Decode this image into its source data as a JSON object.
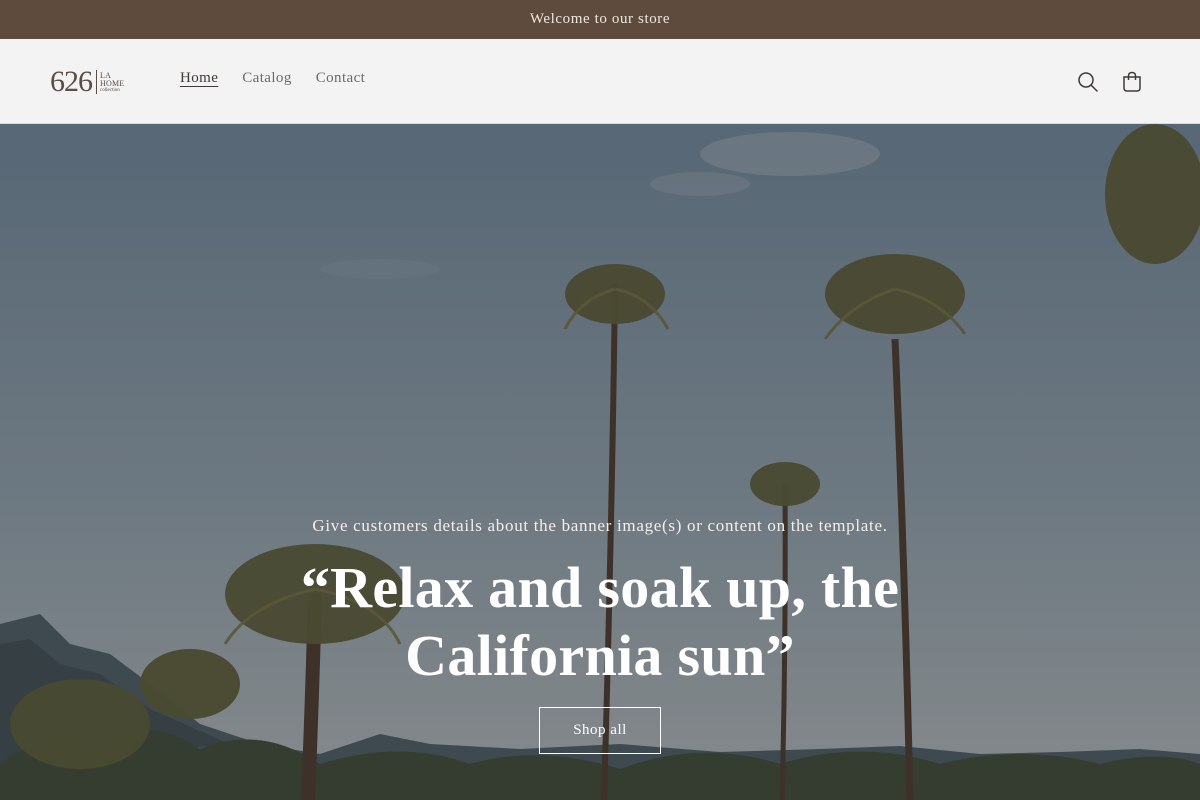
{
  "announcement": {
    "text": "Welcome to our store"
  },
  "logo": {
    "number": "626",
    "line1": "LA",
    "line2": "HOME",
    "line3": "collection"
  },
  "nav": {
    "items": [
      {
        "label": "Home",
        "active": true
      },
      {
        "label": "Catalog",
        "active": false
      },
      {
        "label": "Contact",
        "active": false
      }
    ]
  },
  "header_icons": {
    "search": "search-icon",
    "cart": "cart-icon"
  },
  "hero": {
    "subtitle": "Give customers details about the banner image(s) or content on the template.",
    "title": "“Relax and soak up, the California sun”",
    "button_label": "Shop all"
  },
  "colors": {
    "announcement_bg": "#5e4b3d",
    "header_bg": "#f3f3f3",
    "text_dark": "#3f3a36"
  }
}
